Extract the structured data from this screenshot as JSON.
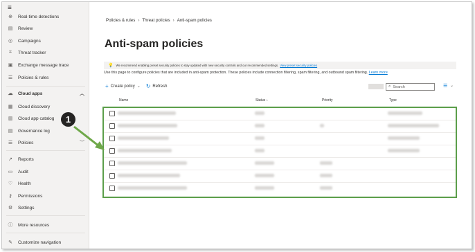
{
  "sidebar": {
    "items": [
      {
        "label": "Real-time detections",
        "icon": "detection-icon",
        "glyph": "⊕"
      },
      {
        "label": "Review",
        "icon": "review-icon",
        "glyph": "▤"
      },
      {
        "label": "Campaigns",
        "icon": "campaigns-icon",
        "glyph": "◎"
      },
      {
        "label": "Threat tracker",
        "icon": "threat-tracker-icon",
        "glyph": "⌗"
      },
      {
        "label": "Exchange message trace",
        "icon": "exchange-icon",
        "glyph": "▣"
      },
      {
        "label": "Policies & rules",
        "icon": "policies-icon",
        "glyph": "☰"
      },
      {
        "label": "Cloud apps",
        "icon": "cloud-icon",
        "glyph": "☁"
      },
      {
        "label": "Cloud discovery",
        "icon": "cloud-discovery-icon",
        "glyph": "▦"
      },
      {
        "label": "Cloud app catalog",
        "icon": "catalog-icon",
        "glyph": "▥"
      },
      {
        "label": "Governance log",
        "icon": "governance-icon",
        "glyph": "▤"
      },
      {
        "label": "Policies",
        "icon": "policies-group-icon",
        "glyph": "☰"
      },
      {
        "label": "Reports",
        "icon": "reports-icon",
        "glyph": "↗"
      },
      {
        "label": "Audit",
        "icon": "audit-icon",
        "glyph": "▭"
      },
      {
        "label": "Health",
        "icon": "health-icon",
        "glyph": "♡"
      },
      {
        "label": "Permissions",
        "icon": "permissions-icon",
        "glyph": "⚷"
      },
      {
        "label": "Settings",
        "icon": "settings-icon",
        "glyph": "⚙"
      },
      {
        "label": "More resources",
        "icon": "info-icon",
        "glyph": "ⓘ"
      },
      {
        "label": "Customize navigation",
        "icon": "edit-icon",
        "glyph": "✎"
      }
    ]
  },
  "breadcrumb": [
    "Policies & rules",
    "Threat policies",
    "Anti-spam policies"
  ],
  "page_title": "Anti-spam policies",
  "banner": {
    "text": "We recommend enabling preset security policies to stay updated with new security controls and our recommended settings.",
    "link": "View preset security policies"
  },
  "description": {
    "text": "Use this page to configure policies that are included in anti-spam protection. These policies include connection filtering, spam filtering, and outbound spam filtering.",
    "link": "Learn more"
  },
  "toolbar": {
    "create_label": "Create policy",
    "refresh_label": "Refresh"
  },
  "search": {
    "placeholder": "Search"
  },
  "columns": {
    "name": "Name",
    "status": "Status",
    "status_sort": "↓",
    "priority": "Priority",
    "type": "Type"
  },
  "callout": {
    "number": "1"
  },
  "colors": {
    "highlight_border": "#5b9e4a",
    "accent": "#0078d4",
    "sidebar_bg": "#f3f2f1"
  }
}
